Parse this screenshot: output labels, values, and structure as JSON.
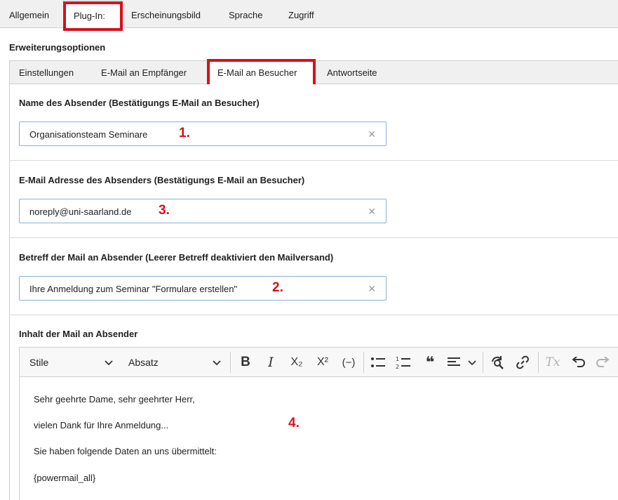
{
  "top_tabs": [
    {
      "label": "Allgemein",
      "active": false
    },
    {
      "label": "Plug-In:",
      "active": true
    },
    {
      "label": "Erscheinungsbild",
      "active": false
    },
    {
      "label": "Sprache",
      "active": false
    },
    {
      "label": "Zugriff",
      "active": false
    }
  ],
  "section": {
    "title": "Erweiterungsoptionen"
  },
  "inner_tabs": [
    {
      "label": "Einstellungen",
      "active": false
    },
    {
      "label": "E-Mail an Empfänger",
      "active": false
    },
    {
      "label": "E-Mail an Besucher",
      "active": true
    },
    {
      "label": "Antwortseite",
      "active": false
    }
  ],
  "fields": [
    {
      "label": "Name des Absender (Bestätigungs E-Mail an Besucher)",
      "value": "Organisationsteam Seminare",
      "marker": "1."
    },
    {
      "label": "E-Mail Adresse des Absenders (Bestätigungs E-Mail an Besucher)",
      "value": "noreply@uni-saarland.de",
      "marker": "3."
    },
    {
      "label": "Betreff der Mail an Absender (Leerer Betreff deaktiviert den Mailversand)",
      "value": "Ihre Anmeldung zum Seminar \"Formulare erstellen\"",
      "marker": "2."
    }
  ],
  "editor": {
    "label": "Inhalt der Mail an Absender",
    "toolbar": {
      "style_select": "Stile",
      "format_select": "Absatz",
      "buttons": [
        {
          "name": "bold-icon",
          "glyph": "B"
        },
        {
          "name": "italic-icon",
          "glyph": "I"
        },
        {
          "name": "subscript-icon",
          "glyph": "X₂"
        },
        {
          "name": "superscript-icon",
          "glyph": "X²"
        },
        {
          "name": "soft-hyphen-icon",
          "glyph": "(−)"
        },
        {
          "name": "bulleted-list-icon"
        },
        {
          "name": "numbered-list-icon"
        },
        {
          "name": "blockquote-icon",
          "glyph": "❝"
        },
        {
          "name": "align-icon"
        },
        {
          "name": "find-replace-icon"
        },
        {
          "name": "link-icon"
        },
        {
          "name": "remove-format-icon",
          "glyph": "Tx"
        },
        {
          "name": "undo-icon"
        },
        {
          "name": "redo-icon"
        }
      ]
    },
    "content_lines": [
      "Sehr geehrte Dame, sehr geehrter Herr,",
      "vielen Dank für Ihre Anmeldung...",
      "Sie haben folgende Daten an uns übermittelt:",
      "{powermail_all}"
    ],
    "marker": "4."
  },
  "colors": {
    "highlight_red": "#d7111c",
    "input_border": "#8cb1d9",
    "tab_bar_bg": "#f0f0f0"
  }
}
